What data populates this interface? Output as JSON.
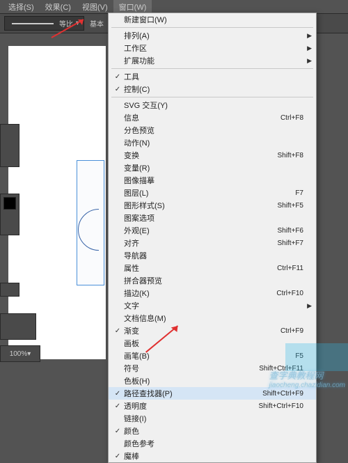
{
  "menubar": {
    "items": [
      "选择(S)",
      "效果(C)",
      "视图(V)",
      "窗口(W)"
    ],
    "active_index": 3
  },
  "toolbar": {
    "stroke_label": "等比",
    "right_label": "基本"
  },
  "zoom": {
    "value": "100%"
  },
  "menu": {
    "items": [
      {
        "label": "新建窗口(W)",
        "sep_after": true
      },
      {
        "label": "排列(A)",
        "arrow": true
      },
      {
        "label": "工作区",
        "arrow": true
      },
      {
        "label": "扩展功能",
        "arrow": true,
        "sep_after": true
      },
      {
        "label": "工具",
        "check": true
      },
      {
        "label": "控制(C)",
        "check": true,
        "sep_after": true
      },
      {
        "label": "SVG 交互(Y)"
      },
      {
        "label": "信息",
        "shortcut": "Ctrl+F8"
      },
      {
        "label": "分色预览"
      },
      {
        "label": "动作(N)"
      },
      {
        "label": "变换",
        "shortcut": "Shift+F8"
      },
      {
        "label": "变量(R)"
      },
      {
        "label": "图像描摹"
      },
      {
        "label": "图层(L)",
        "shortcut": "F7"
      },
      {
        "label": "图形样式(S)",
        "shortcut": "Shift+F5"
      },
      {
        "label": "图案选项"
      },
      {
        "label": "外观(E)",
        "shortcut": "Shift+F6"
      },
      {
        "label": "对齐",
        "shortcut": "Shift+F7"
      },
      {
        "label": "导航器"
      },
      {
        "label": "属性",
        "shortcut": "Ctrl+F11"
      },
      {
        "label": "拼合器预览"
      },
      {
        "label": "描边(K)",
        "shortcut": "Ctrl+F10"
      },
      {
        "label": "文字",
        "arrow": true
      },
      {
        "label": "文档信息(M)"
      },
      {
        "label": "渐变",
        "shortcut": "Ctrl+F9",
        "check": true
      },
      {
        "label": "画板"
      },
      {
        "label": "画笔(B)",
        "shortcut": "F5"
      },
      {
        "label": "符号",
        "shortcut": "Shift+Ctrl+F11"
      },
      {
        "label": "色板(H)"
      },
      {
        "label": "路径查找器(P)",
        "shortcut": "Shift+Ctrl+F9",
        "check": true,
        "hover": true
      },
      {
        "label": "透明度",
        "shortcut": "Shift+Ctrl+F10",
        "check": true
      },
      {
        "label": "链接(I)"
      },
      {
        "label": "颜色",
        "check": true
      },
      {
        "label": "颜色参考"
      },
      {
        "label": "魔棒",
        "check": true
      }
    ]
  },
  "watermark": {
    "line1": "查字典教程网",
    "line2": "jiaocheng.chazidian.com"
  }
}
